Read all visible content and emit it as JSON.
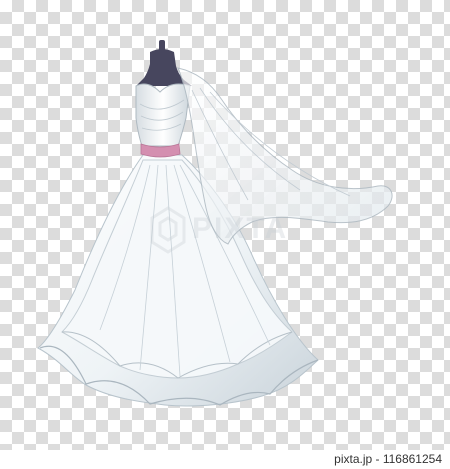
{
  "watermark": {
    "text": "PIXTA"
  },
  "footer": {
    "stock_id": "pixta.jp - 116861254"
  },
  "colors": {
    "checker_dark": "#dcdcdc",
    "checker_light": "#ffffff",
    "dress_white": "#f4f8fb",
    "dress_shadow": "#b7c3cc",
    "mannequin": "#47465e",
    "belt": "#d48fb0"
  },
  "icons": {
    "watermark_logo": "pixta-logo-icon"
  }
}
